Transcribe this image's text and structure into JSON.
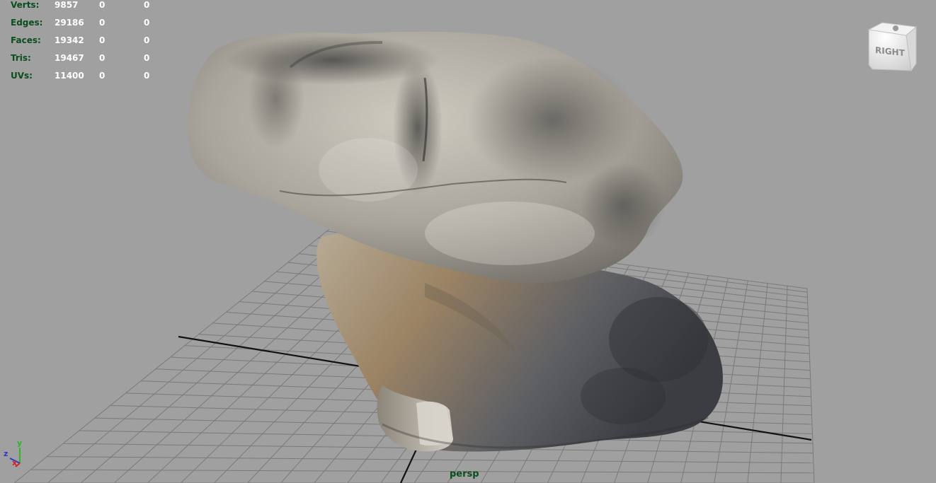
{
  "hud": {
    "rows": [
      {
        "label": "Verts:",
        "values": [
          "9857",
          "0",
          "0"
        ]
      },
      {
        "label": "Edges:",
        "values": [
          "29186",
          "0",
          "0"
        ]
      },
      {
        "label": "Faces:",
        "values": [
          "19342",
          "0",
          "0"
        ]
      },
      {
        "label": "Tris:",
        "values": [
          "19467",
          "0",
          "0"
        ]
      },
      {
        "label": "UVs:",
        "values": [
          "11400",
          "0",
          "0"
        ]
      }
    ]
  },
  "viewport": {
    "camera_name": "persp",
    "viewcube_face": "RIGHT",
    "background_color": "#a0a0a0",
    "grid_color": "#7a7a7a",
    "axis_line_color": "#111111"
  },
  "axis_gizmo": {
    "x_label": "x",
    "y_label": "y",
    "z_label": "z",
    "colors": {
      "x": "#d42020",
      "y": "#2db52d",
      "z": "#2a3acb"
    }
  },
  "icons": {
    "viewcube": "view-cube-icon",
    "axis": "axis-gizmo-icon"
  }
}
